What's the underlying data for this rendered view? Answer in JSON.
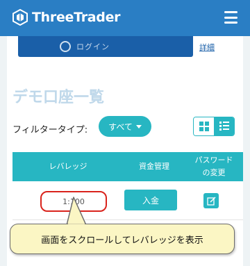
{
  "header": {
    "brand": "ThreeTrader",
    "logo_icon": "threetrader-logo-icon",
    "menu_icon": "hamburger-menu-icon"
  },
  "account_action": {
    "button_label": "ログイン",
    "link_label": "詳細"
  },
  "page": {
    "title": "デモ口座一覧"
  },
  "filter": {
    "label": "フィルタータイプ:",
    "selected": "すべて"
  },
  "view_toggle": {
    "grid_icon": "grid-view-icon",
    "list_icon": "list-view-icon",
    "active": "list"
  },
  "table": {
    "columns": [
      "レバレッジ",
      "資金管理",
      "パスワード",
      "の変更"
    ],
    "rows": [
      {
        "leverage": "1:100",
        "deposit_label": "入金",
        "edit_icon": "edit-icon"
      }
    ]
  },
  "callout": {
    "text": "画面をスクロールしてレバレッジを表示"
  },
  "colors": {
    "header": "#2a7ec4",
    "accent": "#27b6c2",
    "highlight": "#d9231c",
    "callout_bg": "#fbf6c4"
  }
}
